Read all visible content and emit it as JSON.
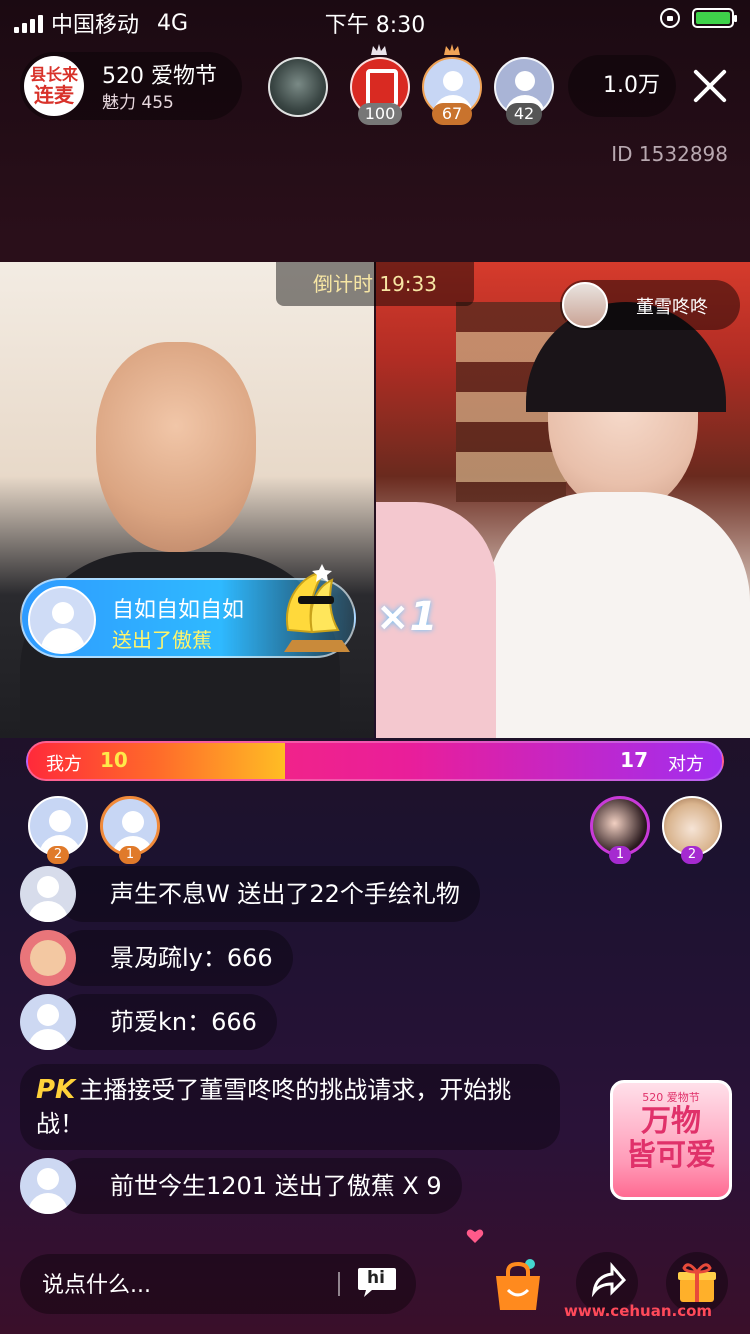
{
  "status_bar": {
    "carrier": "中国移动",
    "network": "4G",
    "time": "下午 8:30"
  },
  "host": {
    "logo_line1": "县长来",
    "logo_line2": "连麦",
    "name": "520 爱物节",
    "charm": "魅力 455"
  },
  "viewers": [
    {
      "badge": ""
    },
    {
      "badge": "100"
    },
    {
      "badge": "67"
    },
    {
      "badge": "42"
    }
  ],
  "audience_count": "1.0万",
  "room_id": "ID 1532898",
  "countdown": "倒计时 19:33",
  "opponent_name": "董雪咚咚",
  "gift_banner": {
    "user": "自如自如自如",
    "gift": "送出了傲蕉",
    "multiplier": "×1"
  },
  "pk": {
    "our_label": "我方",
    "our_score": "10",
    "their_score": "17",
    "their_label": "对方",
    "our_fraction": 0.37
  },
  "contributors_left": [
    {
      "rank": "2"
    },
    {
      "rank": "1"
    }
  ],
  "contributors_right": [
    {
      "rank": "1"
    },
    {
      "rank": "2"
    }
  ],
  "chat": [
    {
      "text": "声生不息W 送出了22个手绘礼物"
    },
    {
      "text": "景夃疏ly：666"
    },
    {
      "text": "茆爱kn：666"
    },
    {
      "text": "前世今生1201 送出了傲蕉 X 9"
    }
  ],
  "system_message": {
    "tag": "PK",
    "text": "主播接受了董雪咚咚的挑战请求，开始挑战！"
  },
  "promo": {
    "small": "520 爱物节",
    "big_line1": "万物",
    "big_line2": "皆可爱"
  },
  "input": {
    "placeholder": "说点什么..."
  },
  "hi_label": "hi",
  "watermark": "www.cehuan.com",
  "colors": {
    "our_bar": "#ffbd24",
    "their_bar": "#e91e9a",
    "gift_text": "#fff56c",
    "countdown_text": "#f7e6a4"
  }
}
